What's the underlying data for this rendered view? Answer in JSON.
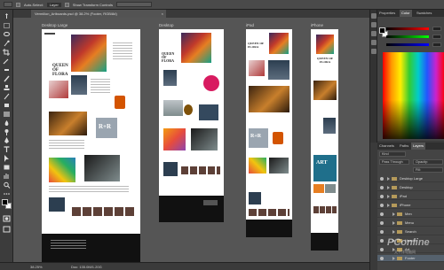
{
  "options_bar": {
    "auto_select_label": "Auto-Select:",
    "auto_select_value": "Layer",
    "transform_label": "Show Transform Controls"
  },
  "document_tab": {
    "title": "Vermilion_Artboards.psd @ 38.2% (Footer, RGB/8#)",
    "close": "×"
  },
  "artboards": [
    {
      "label": "Desktop Large"
    },
    {
      "label": "Desktop"
    },
    {
      "label": "iPad"
    },
    {
      "label": "iPhone"
    }
  ],
  "artwork": {
    "queen_text": "QUEEN OF FLORA",
    "rr_text": "R+R",
    "art_text": "ART"
  },
  "status_bar": {
    "zoom": "38.25%",
    "doc": "Doc: 135.0M/1.20G"
  },
  "panels": {
    "top_tabs": [
      "Properties",
      "Color",
      "Swatches"
    ],
    "layer_tabs": [
      "Channels",
      "Paths",
      "Layers"
    ],
    "kind": "Kind",
    "blend_mode": "Pass Through",
    "opacity_label": "Opacity:",
    "fill_label": "Fill:",
    "layers": [
      {
        "name": "Desktop Large",
        "indent": 0,
        "type": "folder",
        "selected": false
      },
      {
        "name": "Desktop",
        "indent": 0,
        "type": "folder",
        "selected": false
      },
      {
        "name": "iPad",
        "indent": 0,
        "type": "folder",
        "selected": false
      },
      {
        "name": "iPhone",
        "indent": 0,
        "type": "folder",
        "selected": false
      },
      {
        "name": "Men",
        "indent": 1,
        "type": "folder",
        "selected": false
      },
      {
        "name": "Menu",
        "indent": 1,
        "type": "folder",
        "selected": false
      },
      {
        "name": "Search",
        "indent": 1,
        "type": "folder",
        "selected": false
      },
      {
        "name": "Header",
        "indent": 1,
        "type": "folder",
        "selected": false
      },
      {
        "name": "Art",
        "indent": 1,
        "type": "folder",
        "selected": false
      },
      {
        "name": "Footer",
        "indent": 1,
        "type": "folder",
        "selected": true
      }
    ]
  },
  "watermark": {
    "text": "PConline",
    "sub": "太平洋电脑网"
  }
}
